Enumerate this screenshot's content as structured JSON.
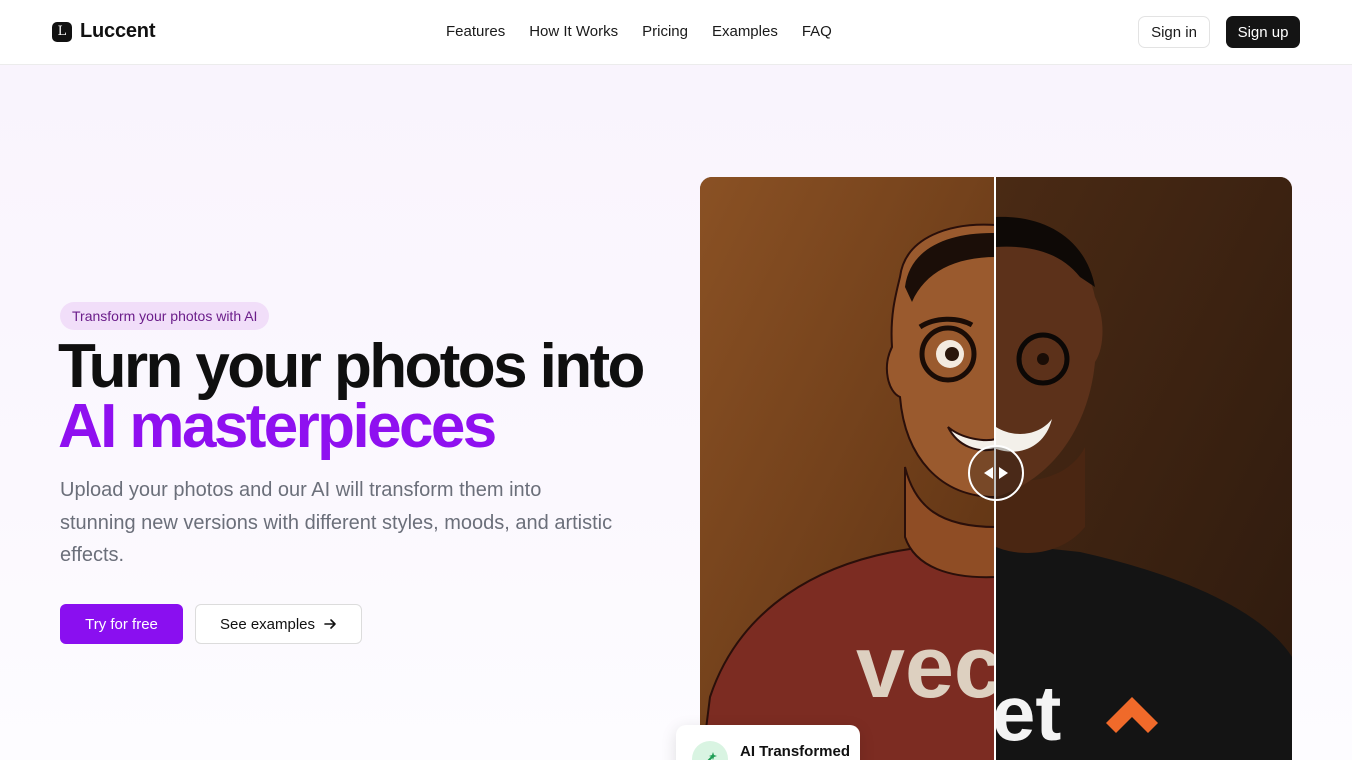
{
  "header": {
    "logo_mark": "L",
    "brand": "Luccent",
    "nav": [
      "Features",
      "How It Works",
      "Pricing",
      "Examples",
      "FAQ"
    ],
    "sign_in": "Sign in",
    "sign_up": "Sign up"
  },
  "hero": {
    "badge": "Transform your photos with AI",
    "headline_line1": "Turn your photos into",
    "headline_line2": "AI masterpieces",
    "subtext": "Upload your photos and our AI will transform them into stunning new versions with different styles, moods, and artistic effects.",
    "cta_primary": "Try for free",
    "cta_secondary": "See examples",
    "cta_secondary_icon": "arrow-right-icon"
  },
  "compare": {
    "left_shirt_text": "vec",
    "right_shirt_text": "et",
    "handle_icon": "compare-slider-icon",
    "card_label": "AI Transformed",
    "card_icon": "sparkle-icon"
  },
  "colors": {
    "accent": "#8a0ff0",
    "badge_bg": "#f1def9",
    "dark": "#141414"
  }
}
